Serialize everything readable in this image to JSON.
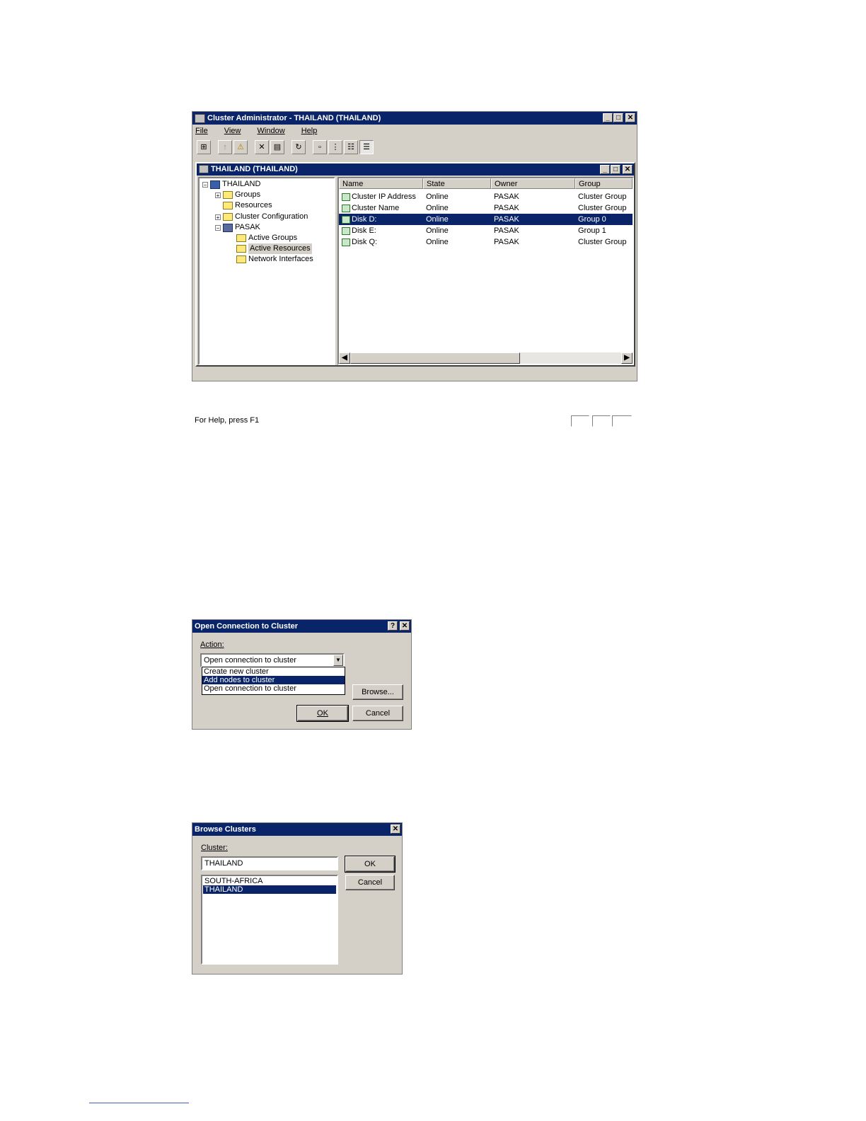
{
  "main_window": {
    "title": "Cluster Administrator - THAILAND (THAILAND)",
    "menu": [
      "File",
      "View",
      "Window",
      "Help"
    ],
    "child_title": "THAILAND (THAILAND)",
    "tree": [
      {
        "label": "THAILAND",
        "icon": "cluster-icon"
      },
      {
        "label": "Groups",
        "icon": "folder-icon"
      },
      {
        "label": "Resources",
        "icon": "folder-icon"
      },
      {
        "label": "Cluster Configuration",
        "icon": "folder-icon"
      },
      {
        "label": "PASAK",
        "icon": "node-icon"
      },
      {
        "label": "Active Groups",
        "icon": "folder-icon"
      },
      {
        "label": "Active Resources",
        "icon": "folder-icon"
      },
      {
        "label": "Network Interfaces",
        "icon": "folder-icon"
      }
    ],
    "columns": [
      "Name",
      "State",
      "Owner",
      "Group"
    ],
    "rows": [
      {
        "name": "Cluster IP Address",
        "state": "Online",
        "owner": "PASAK",
        "group": "Cluster Group"
      },
      {
        "name": "Cluster Name",
        "state": "Online",
        "owner": "PASAK",
        "group": "Cluster Group"
      },
      {
        "name": "Disk D:",
        "state": "Online",
        "owner": "PASAK",
        "group": "Group 0"
      },
      {
        "name": "Disk E:",
        "state": "Online",
        "owner": "PASAK",
        "group": "Group 1"
      },
      {
        "name": "Disk Q:",
        "state": "Online",
        "owner": "PASAK",
        "group": "Cluster Group"
      }
    ],
    "status": "For Help, press F1"
  },
  "open_dialog": {
    "title": "Open Connection to Cluster",
    "action_label": "Action:",
    "action_value": "Open connection to cluster",
    "options": [
      "Create new cluster",
      "Add nodes to cluster",
      "Open connection to cluster"
    ],
    "browse_label": "Browse...",
    "ok_label": "OK",
    "cancel_label": "Cancel"
  },
  "browse_dialog": {
    "title": "Browse Clusters",
    "cluster_label": "Cluster:",
    "cluster_value": "THAILAND",
    "list": [
      "SOUTH-AFRICA",
      "THAILAND"
    ],
    "ok_label": "OK",
    "cancel_label": "Cancel"
  }
}
